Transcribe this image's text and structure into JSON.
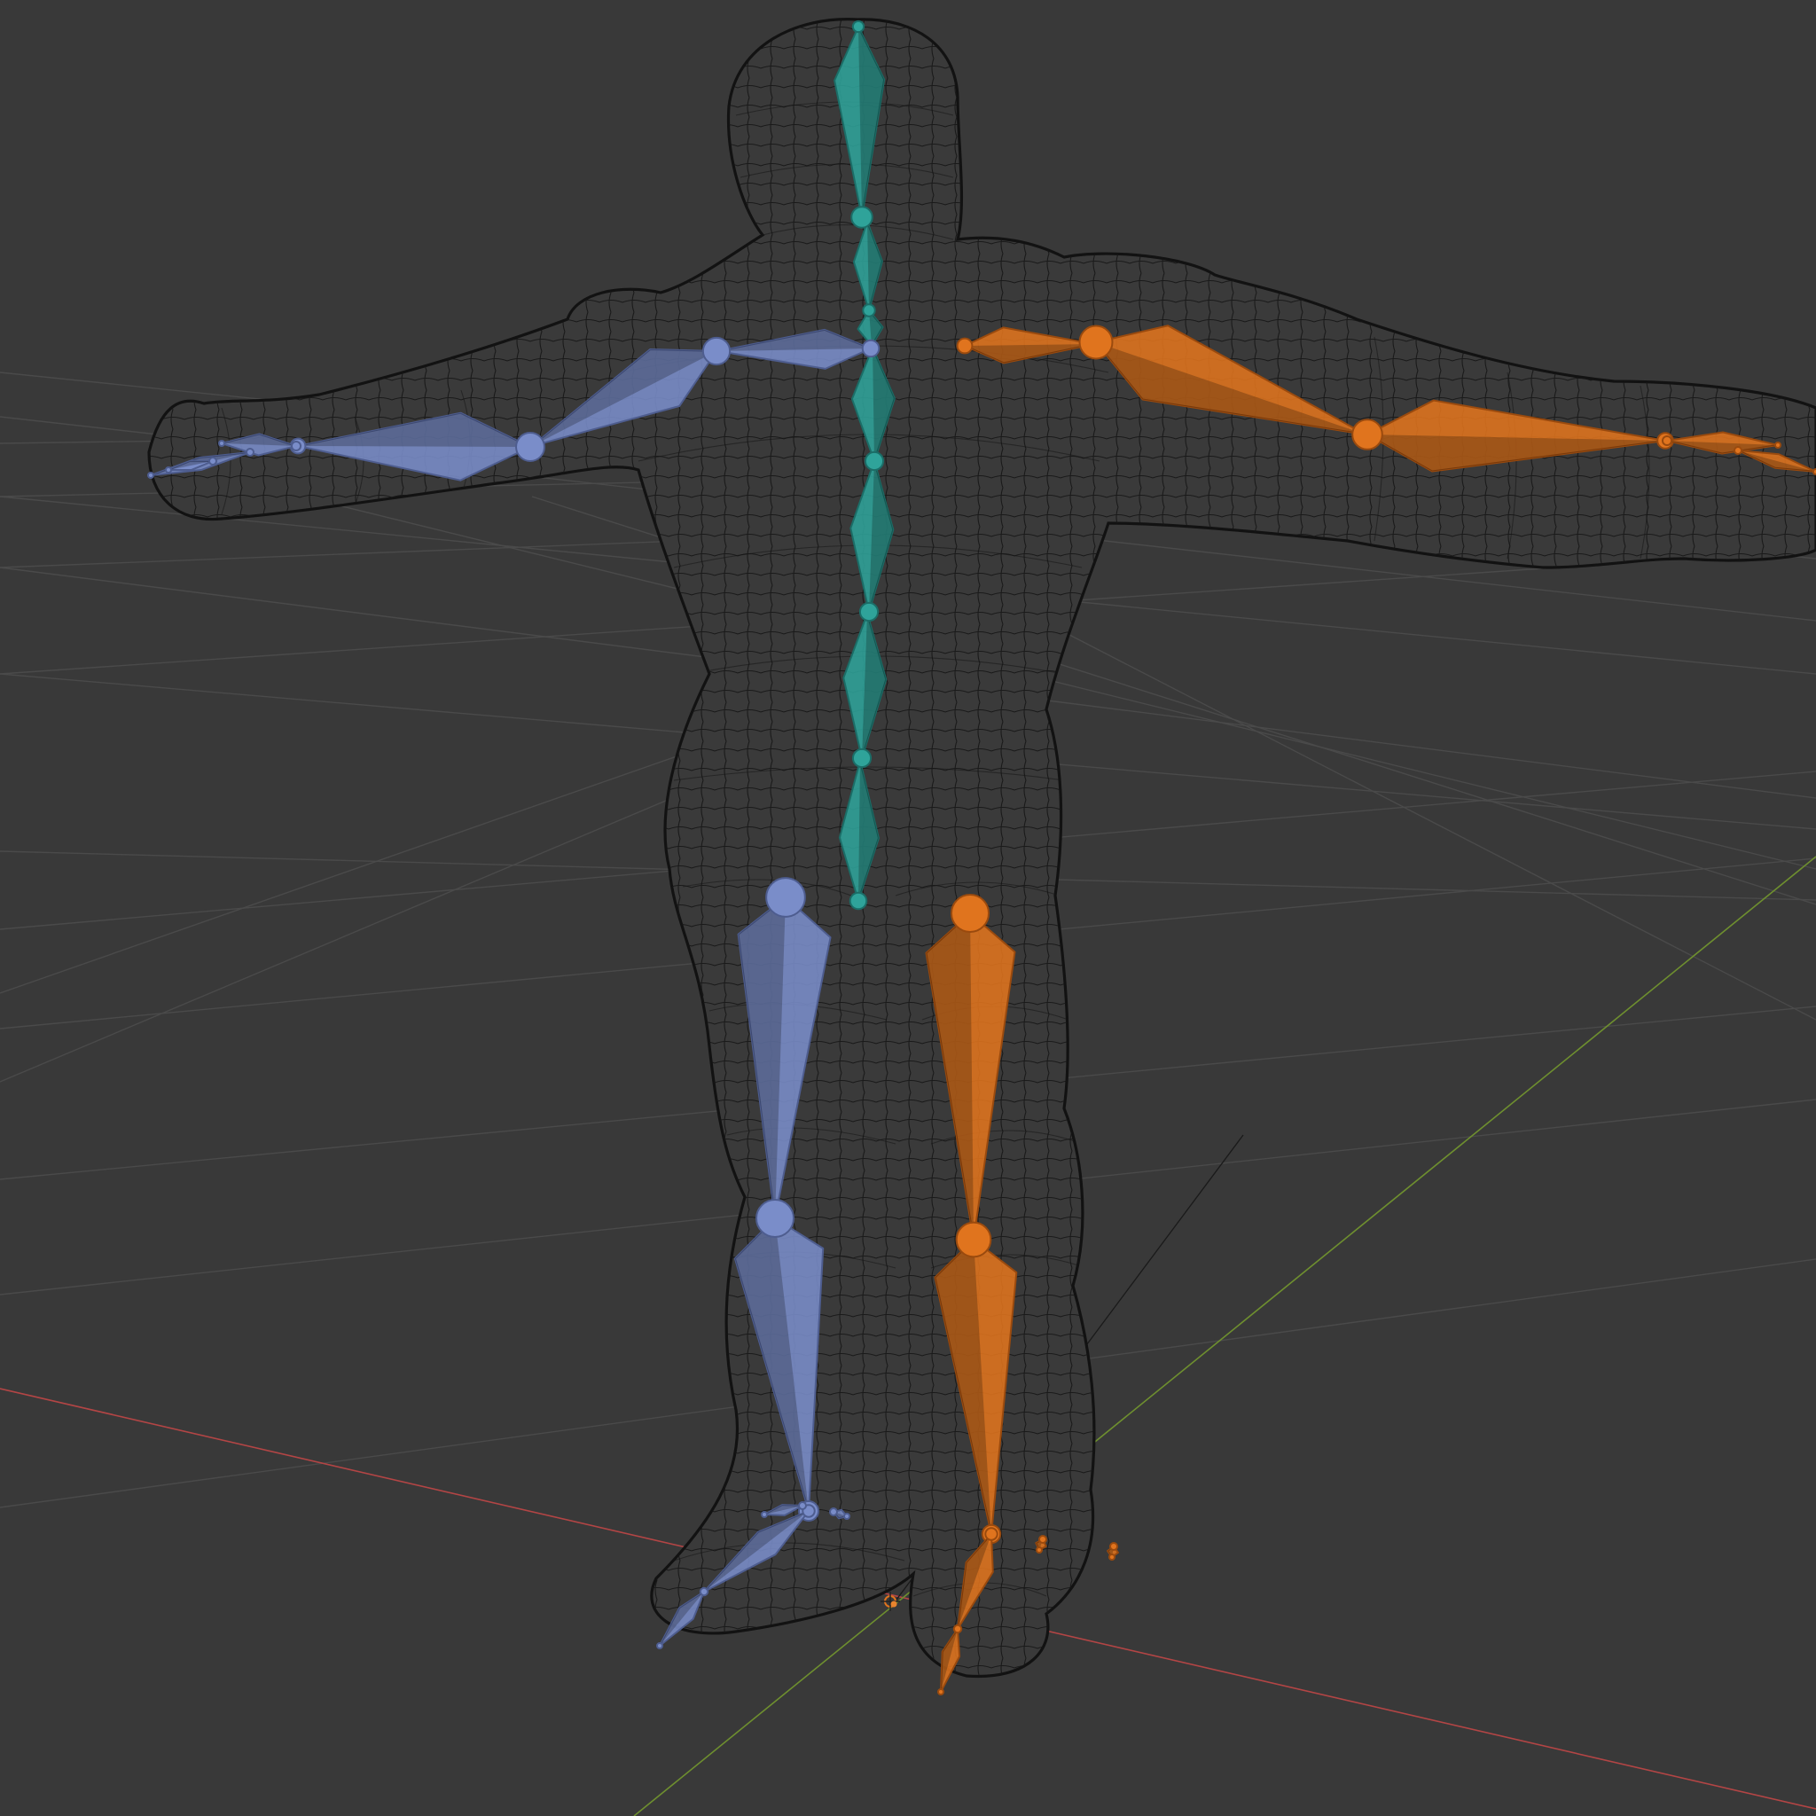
{
  "viewport": {
    "background": "#393939",
    "grid_color": "#4a4a4a",
    "x_axis_color": "#b34545",
    "y_axis_color": "#6e8f2f",
    "z_axis_color": "#1a1a1a",
    "wireframe_color": "#121212"
  },
  "armature": {
    "groups": [
      {
        "name": "spine",
        "color": "#2fa39a",
        "edge": "#1b6d67"
      },
      {
        "name": "left-limbs",
        "color": "#7a8dc9",
        "edge": "#4e5d8f"
      },
      {
        "name": "right-limbs",
        "color": "#e0741e",
        "edge": "#9a4a0e"
      }
    ]
  },
  "icons": {
    "origin": "origin-point-icon",
    "cursor": "3d-cursor-icon"
  }
}
